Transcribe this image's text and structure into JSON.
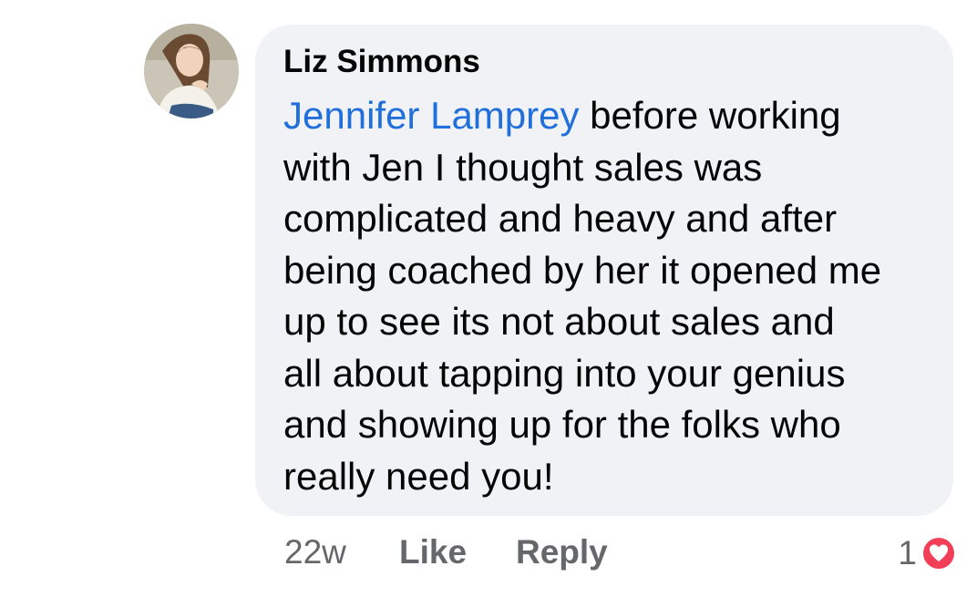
{
  "comment": {
    "author": "Liz Simmons",
    "mention": "Jennifer Lamprey",
    "text_lines": [
      " before working",
      "with Jen I thought sales was",
      "complicated and heavy and after",
      "being coached by her it opened me",
      "up to see its not about sales and",
      "all about tapping into your genius",
      "and showing up for the folks  who",
      "really need you!"
    ]
  },
  "actions": {
    "time": "22w",
    "like": "Like",
    "reply": "Reply"
  },
  "reactions": {
    "count": "1",
    "icon": "heart-icon",
    "color": "#f33e58"
  },
  "colors": {
    "bubble": "#f0f2f5",
    "mention": "#216fdb",
    "secondary_text": "#65676b",
    "primary_text": "#050505"
  }
}
